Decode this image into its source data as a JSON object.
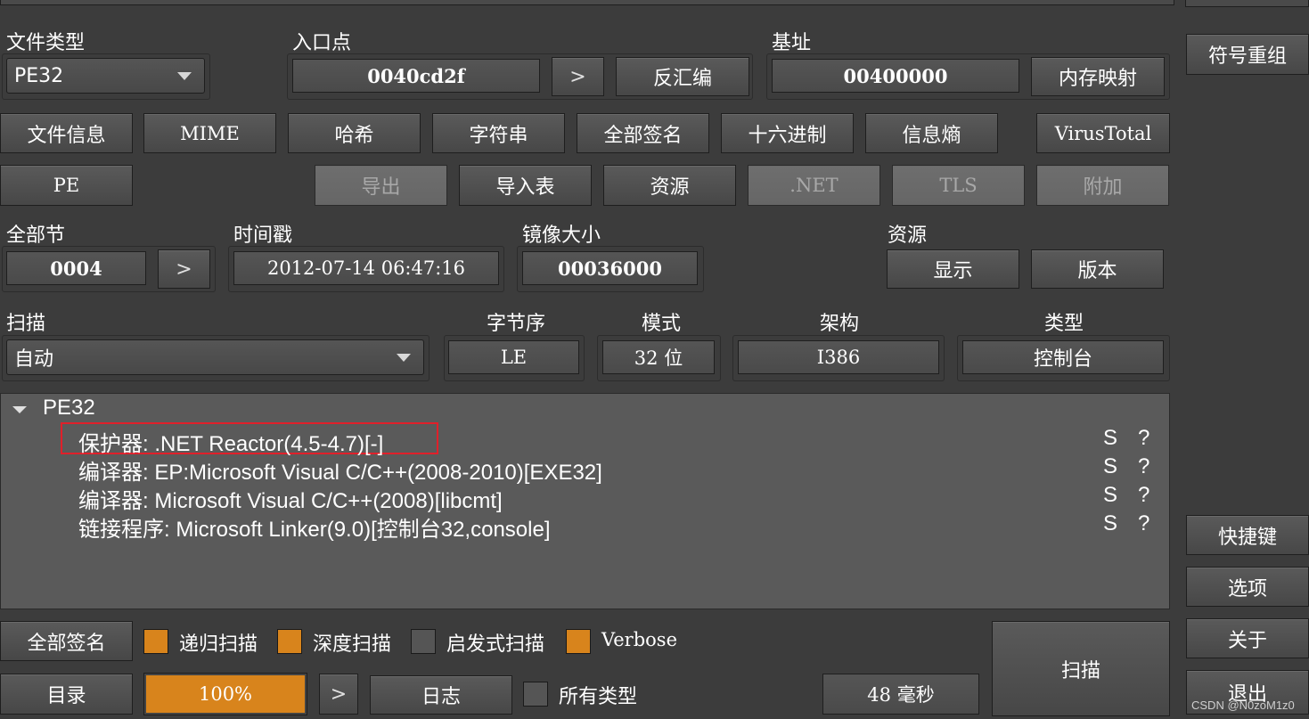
{
  "top": {
    "file_type_label": "文件类型",
    "file_type_value": "PE32",
    "entry_point_label": "入口点",
    "entry_point_value": "0040cd2f",
    "entry_point_next": ">",
    "disasm_button": "反汇编",
    "base_label": "基址",
    "base_value": "00400000",
    "memory_map_button": "内存映射",
    "symbol_button": "符号重组"
  },
  "info_buttons": [
    "文件信息",
    "MIME",
    "哈希",
    "字符串",
    "全部签名",
    "十六进制",
    "信息熵",
    "VirusTotal"
  ],
  "pe_buttons": {
    "pe": "PE",
    "export": "导出",
    "import": "导入表",
    "resources": "资源",
    "net": ".NET",
    "tls": "TLS",
    "overlay": "附加"
  },
  "sections": {
    "sections_label": "全部节",
    "sections_value": "0004",
    "sections_next": ">",
    "timestamp_label": "时间戳",
    "timestamp_value": "2012-07-14 06:47:16",
    "image_size_label": "镜像大小",
    "image_size_value": "00036000",
    "resources_label": "资源",
    "show_button": "显示",
    "version_button": "版本"
  },
  "scan_row": {
    "scan_label": "扫描",
    "scan_value": "自动",
    "endian_label": "字节序",
    "endian_value": "LE",
    "mode_label": "模式",
    "mode_value": "32 位",
    "arch_label": "架构",
    "arch_value": "I386",
    "type_label": "类型",
    "type_value": "控制台"
  },
  "results": {
    "root": "PE32",
    "items": [
      {
        "text": "保护器: .NET Reactor(4.5-4.7)[-]",
        "s": "S",
        "q": "?"
      },
      {
        "text": "编译器: EP:Microsoft Visual C/C++(2008-2010)[EXE32]",
        "s": "S",
        "q": "?"
      },
      {
        "text": "编译器: Microsoft Visual C/C++(2008)[libcmt]",
        "s": "S",
        "q": "?"
      },
      {
        "text": "链接程序: Microsoft Linker(9.0)[控制台32,console]",
        "s": "S",
        "q": "?"
      }
    ],
    "highlight_color": "#e0202a"
  },
  "bottom": {
    "all_signatures_button": "全部签名",
    "recursive_label": "递归扫描",
    "recursive_checked": true,
    "deep_label": "深度扫描",
    "deep_checked": true,
    "heuristic_label": "启发式扫描",
    "heuristic_checked": false,
    "verbose_label": "Verbose",
    "verbose_checked": true,
    "directory_button": "目录",
    "progress_text": "100%",
    "progress_value": 1.0,
    "progress_next": ">",
    "log_button": "日志",
    "all_types_label": "所有类型",
    "all_types_checked": false,
    "time_value": "48 毫秒",
    "scan_button": "扫描"
  },
  "right": {
    "shortcuts_button": "快捷键",
    "options_button": "选项",
    "about_button": "关于",
    "exit_button": "退出"
  },
  "watermark": "CSDN @N0zoM1z0",
  "colors": {
    "accent": "#d8841c",
    "background": "#3c3c3c",
    "list_bg": "#5a5a5a"
  }
}
